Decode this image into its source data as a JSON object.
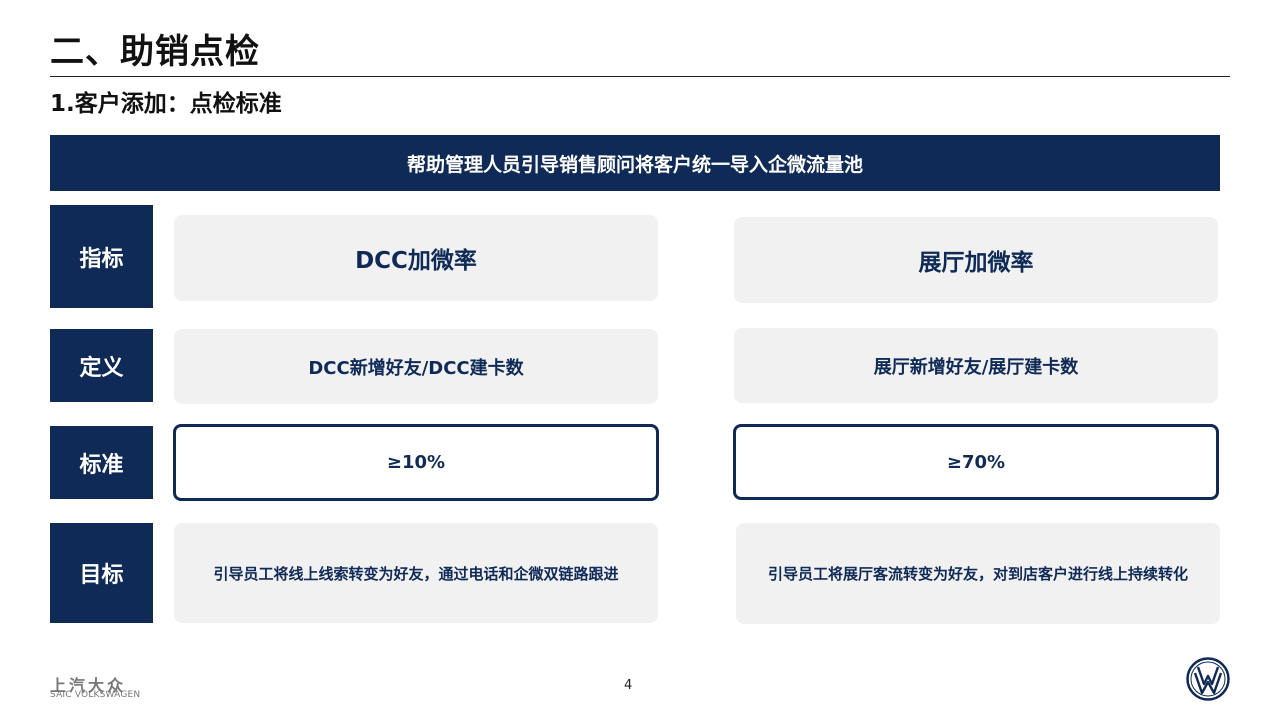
{
  "header": {
    "title": "二、助销点检",
    "subtitle": "1.客户添加：点检标准"
  },
  "banner": "帮助管理人员引导销售顾问将客户统一导入企微流量池",
  "rows": {
    "metric": {
      "label": "指标",
      "dcc": "DCC加微率",
      "showroom": "展厅加微率"
    },
    "definition": {
      "label": "定义",
      "dcc": "DCC新增好友/DCC建卡数",
      "showroom": "展厅新增好友/展厅建卡数"
    },
    "standard": {
      "label": "标准",
      "dcc": "≥10%",
      "showroom": "≥70%"
    },
    "goal": {
      "label": "目标",
      "dcc": "引导员工将线上线索转变为好友，通过电话和企微双链路跟进",
      "showroom": "引导员工将展厅客流转变为好友，对到店客户进行线上持续转化"
    }
  },
  "footer": {
    "brand_cn": "上汽大众",
    "brand_en": "SAIC VOLKSWAGEN",
    "page_number": "4",
    "logo_icon": "vw-logo-icon"
  },
  "colors": {
    "navy": "#0f2a56",
    "cell_gray": "#f1f1f2"
  }
}
